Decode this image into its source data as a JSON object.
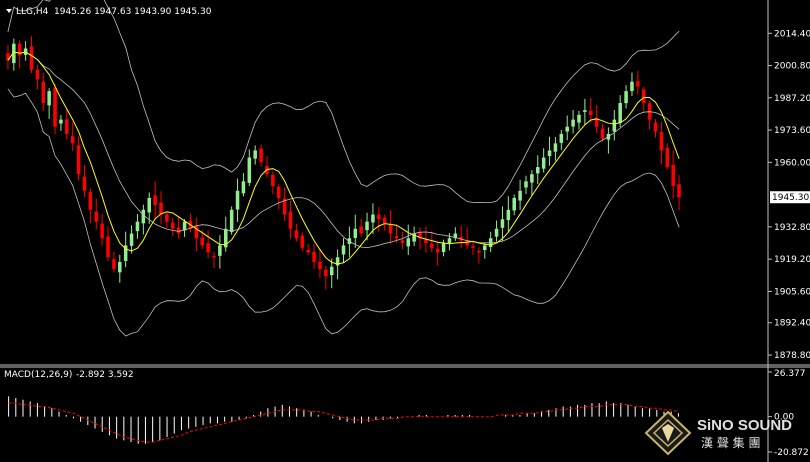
{
  "header": {
    "symbol": "LLG,H4",
    "ohlc": "1945.26 1947.63 1943.90 1945.30"
  },
  "macd_header": {
    "label": "MACD(12,26,9)",
    "values": "-2.892 3.592"
  },
  "price_axis": {
    "ticks": [
      "2014.40",
      "2000.80",
      "1987.20",
      "1973.60",
      "1960.00",
      "1945.30",
      "1932.80",
      "1919.20",
      "1905.60",
      "1892.40",
      "1878.80"
    ],
    "current_price": "1945.30"
  },
  "macd_axis": {
    "ticks": [
      "26.377",
      "0.00",
      "-20.872"
    ]
  },
  "logo": {
    "line1": "SiNO SOUND",
    "line2": "漢 聲 集 團"
  },
  "colors": {
    "background": "#000000",
    "up_candle": "#90ee90",
    "down_candle": "#ff0000",
    "moving_average": "#ffff00",
    "bollinger": "#c0c0c0",
    "macd_histogram": "#ffffff",
    "macd_signal": "#ff0000",
    "logo_gold": "#c8b26a"
  },
  "chart_data": [
    {
      "type": "candlestick",
      "title": "LLG,H4",
      "ylim": [
        1878.8,
        2020
      ],
      "overlays": [
        "moving-average",
        "bollinger-bands"
      ],
      "close_trend": [
        2003,
        2010,
        2005,
        2008,
        1999,
        1995,
        1985,
        1990,
        1975,
        1978,
        1972,
        1968,
        1955,
        1948,
        1940,
        1935,
        1928,
        1920,
        1915,
        1918,
        1925,
        1930,
        1935,
        1940,
        1945,
        1942,
        1938,
        1935,
        1932,
        1930,
        1935,
        1932,
        1928,
        1925,
        1922,
        1920,
        1925,
        1932,
        1940,
        1948,
        1952,
        1962,
        1965,
        1960,
        1955,
        1950,
        1945,
        1938,
        1932,
        1928,
        1924,
        1922,
        1918,
        1915,
        1912,
        1916,
        1920,
        1925,
        1928,
        1932,
        1930,
        1935,
        1938,
        1936,
        1934,
        1930,
        1928,
        1926,
        1928,
        1930,
        1928,
        1926,
        1924,
        1922,
        1926,
        1928,
        1930,
        1927,
        1925,
        1924,
        1922,
        1925,
        1928,
        1932,
        1936,
        1940,
        1945,
        1948,
        1952,
        1955,
        1958,
        1962,
        1965,
        1968,
        1972,
        1975,
        1978,
        1980,
        1982,
        1980,
        1975,
        1970,
        1972,
        1978,
        1985,
        1990,
        1994,
        1992,
        1985,
        1978,
        1973,
        1965,
        1958,
        1950,
        1945.3
      ]
    },
    {
      "type": "bar",
      "title": "MACD(12,26,9)",
      "ylim": [
        -20.872,
        26.377
      ],
      "macd_trend": [
        12,
        11,
        10,
        9,
        8,
        6,
        5,
        3,
        1,
        -1,
        -3,
        -5,
        -7,
        -9,
        -11,
        -13,
        -14,
        -15,
        -16,
        -16,
        -15,
        -14,
        -12,
        -10,
        -8,
        -7,
        -6,
        -5,
        -4,
        -4,
        -3,
        -3,
        -2,
        -1,
        1,
        3,
        5,
        6,
        7,
        6,
        5,
        4,
        3,
        1,
        0,
        -1,
        -2,
        -3,
        -4,
        -4,
        -3,
        -2,
        -2,
        -1,
        -1,
        0,
        0,
        1,
        1,
        0,
        0,
        1,
        1,
        1,
        1,
        0,
        0,
        0,
        0,
        1,
        1,
        1,
        2,
        2,
        3,
        4,
        5,
        6,
        6,
        7,
        7,
        8,
        8,
        9,
        8,
        8,
        7,
        6,
        5,
        5,
        4,
        3,
        3,
        2
      ],
      "signal_trend": [
        8,
        8,
        7,
        7,
        6,
        6,
        5,
        4,
        3,
        2,
        0,
        -2,
        -4,
        -6,
        -8,
        -10,
        -12,
        -13,
        -14,
        -15,
        -15,
        -14,
        -13,
        -12,
        -11,
        -9,
        -8,
        -7,
        -6,
        -5,
        -4,
        -3,
        -2,
        -1,
        0,
        1,
        2,
        3,
        4,
        4,
        4,
        4,
        3,
        3,
        2,
        1,
        0,
        -1,
        -2,
        -2,
        -2,
        -2,
        -1,
        -1,
        -1,
        0,
        0,
        0,
        0,
        0,
        0,
        0,
        0,
        0,
        0,
        0,
        0,
        0,
        1,
        1,
        1,
        2,
        2,
        2,
        3,
        3,
        4,
        4,
        5,
        5,
        6,
        6,
        6,
        7,
        7,
        7,
        7,
        6,
        6,
        5,
        5,
        4,
        4,
        3
      ]
    }
  ]
}
